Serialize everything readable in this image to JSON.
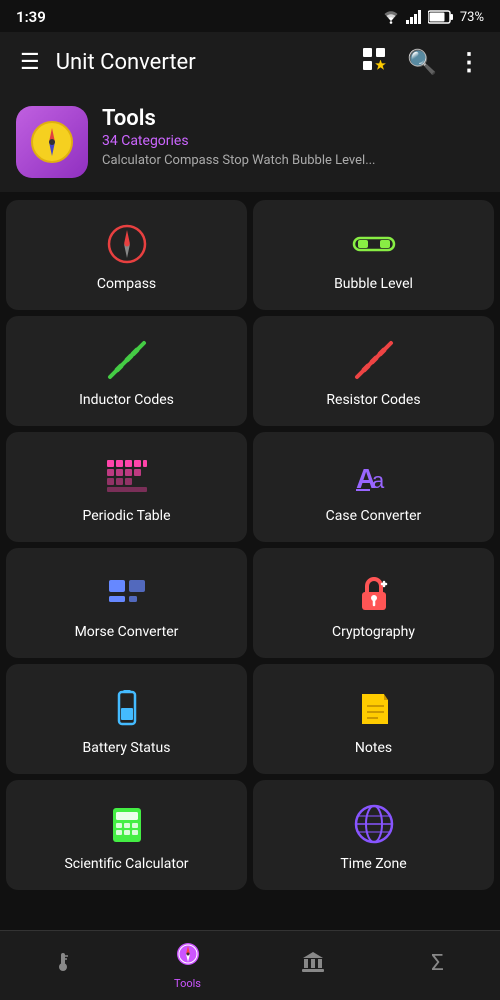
{
  "statusBar": {
    "time": "1:39",
    "battery": "73%"
  },
  "topBar": {
    "title": "Unit Converter",
    "icons": [
      "grid-star-icon",
      "search-icon",
      "more-icon"
    ]
  },
  "header": {
    "appName": "Tools",
    "categories": "34 Categories",
    "description": "Calculator Compass Stop Watch Bubble Level..."
  },
  "grid": {
    "items": [
      {
        "id": "compass",
        "label": "Compass",
        "iconColor": "#e84040"
      },
      {
        "id": "bubble-level",
        "label": "Bubble Level",
        "iconColor": "#88ee44"
      },
      {
        "id": "inductor-codes",
        "label": "Inductor Codes",
        "iconColor": "#44cc44"
      },
      {
        "id": "resistor-codes",
        "label": "Resistor Codes",
        "iconColor": "#ee4444"
      },
      {
        "id": "periodic-table",
        "label": "Periodic Table",
        "iconColor": "#ff44aa"
      },
      {
        "id": "case-converter",
        "label": "Case Converter",
        "iconColor": "#9966ff"
      },
      {
        "id": "morse-converter",
        "label": "Morse Converter",
        "iconColor": "#6688ff"
      },
      {
        "id": "cryptography",
        "label": "Cryptography",
        "iconColor": "#ff5555"
      },
      {
        "id": "battery-status",
        "label": "Battery Status",
        "iconColor": "#44bbff"
      },
      {
        "id": "notes",
        "label": "Notes",
        "iconColor": "#ffcc00"
      },
      {
        "id": "scientific-calculator",
        "label": "Scientific Calculator",
        "iconColor": "#44ee44"
      },
      {
        "id": "time-zone",
        "label": "Time Zone",
        "iconColor": "#8855ff"
      }
    ]
  },
  "bottomNav": {
    "items": [
      {
        "id": "thermometer",
        "label": "",
        "icon": "thermometer-icon",
        "active": false
      },
      {
        "id": "tools",
        "label": "Tools",
        "icon": "compass-nav-icon",
        "active": true
      },
      {
        "id": "bank",
        "label": "",
        "icon": "bank-icon",
        "active": false
      },
      {
        "id": "sigma",
        "label": "",
        "icon": "sigma-icon",
        "active": false
      }
    ]
  }
}
